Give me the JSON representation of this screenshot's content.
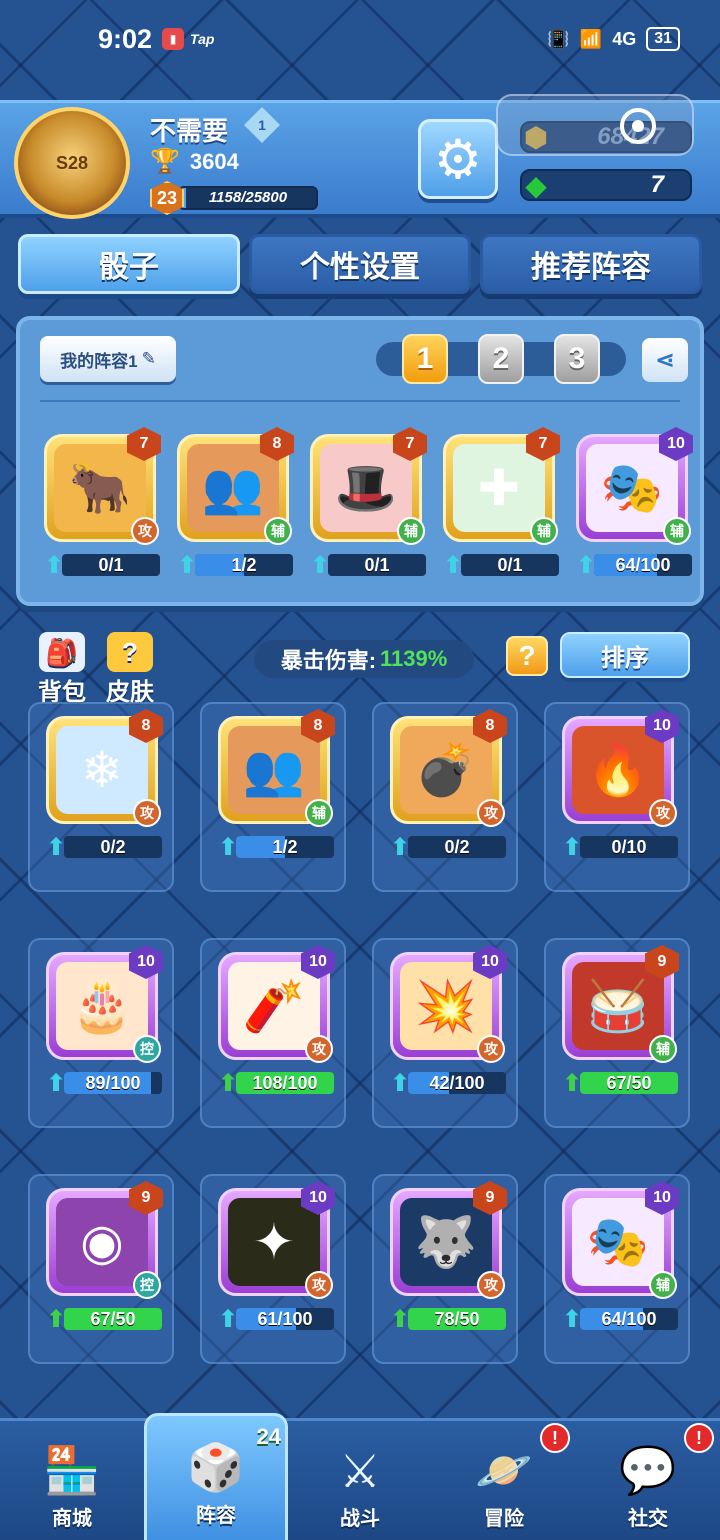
{
  "status_bar": {
    "time": "9:02",
    "app_tag": "Tap",
    "network": "4G",
    "battery": "31"
  },
  "header": {
    "rank_badge": "S28",
    "player_name": "不需要",
    "vip_level": "1",
    "trophies": "3604",
    "level": "23",
    "xp_text": "1158/25800",
    "xp_fraction": 0.045,
    "coins": "68427",
    "gems": "7"
  },
  "tabs": [
    {
      "label": "骰子",
      "active": true
    },
    {
      "label": "个性设置",
      "active": false
    },
    {
      "label": "推荐阵容",
      "active": false
    }
  ],
  "lineup": {
    "my_lineup_label": "我的阵容1",
    "slots": [
      "1",
      "2",
      "3"
    ],
    "active_slot": "1",
    "dice": [
      {
        "icon": "bull-icon",
        "glyph": "🐂",
        "level": "7",
        "type": "攻",
        "progress": "0/1",
        "fraction": 0.0,
        "frame": "gold",
        "bg": "#f2b64a"
      },
      {
        "icon": "twins-icon",
        "glyph": "👥",
        "level": "8",
        "type": "辅",
        "progress": "1/2",
        "fraction": 0.5,
        "frame": "gold",
        "bg": "#e59a5c"
      },
      {
        "icon": "hat-icon",
        "glyph": "🎩",
        "level": "7",
        "type": "辅",
        "progress": "0/1",
        "fraction": 0.0,
        "frame": "gold",
        "bg": "#f7c9c9"
      },
      {
        "icon": "heal-cross-icon",
        "glyph": "✚",
        "level": "7",
        "type": "辅",
        "progress": "0/1",
        "fraction": 0.0,
        "frame": "gold",
        "bg": "#dff5df"
      },
      {
        "icon": "mask-icon",
        "glyph": "🎭",
        "level": "10",
        "type": "辅",
        "progress": "64/100",
        "fraction": 0.64,
        "frame": "purple",
        "bg": "#f7e9ff"
      }
    ]
  },
  "collection": {
    "bag_label": "背包",
    "skin_label": "皮肤",
    "crit_label": "暴击伤害:",
    "crit_value": "1139%",
    "sort_label": "排序",
    "dice": [
      {
        "icon": "ice-spirit-icon",
        "glyph": "❄",
        "level": "8",
        "type": "攻",
        "progress": "0/2",
        "fraction": 0.0,
        "frame": "gold",
        "bg": "#cfe9ff",
        "arrow": "cyan"
      },
      {
        "icon": "twins-icon",
        "glyph": "👥",
        "level": "8",
        "type": "辅",
        "progress": "1/2",
        "fraction": 0.5,
        "frame": "gold",
        "bg": "#e59a5c",
        "arrow": "cyan"
      },
      {
        "icon": "bomb-icon",
        "glyph": "💣",
        "level": "8",
        "type": "攻",
        "progress": "0/2",
        "fraction": 0.0,
        "frame": "gold",
        "bg": "#f0a85a",
        "arrow": "cyan"
      },
      {
        "icon": "claw-icon",
        "glyph": "🔥",
        "level": "10",
        "type": "攻",
        "progress": "0/10",
        "fraction": 0.0,
        "frame": "purple",
        "bg": "#d9542a",
        "arrow": "cyan"
      },
      {
        "icon": "cake-icon",
        "glyph": "🎂",
        "level": "10",
        "type": "控",
        "progress": "89/100",
        "fraction": 0.89,
        "frame": "purple",
        "bg": "#ffe6cc",
        "arrow": "cyan"
      },
      {
        "icon": "firecracker-icon",
        "glyph": "🧨",
        "level": "10",
        "type": "攻",
        "progress": "108/100",
        "fraction": 1.0,
        "frame": "purple",
        "bg": "#fff3e6",
        "arrow": "green"
      },
      {
        "icon": "explosion-icon",
        "glyph": "💥",
        "level": "10",
        "type": "攻",
        "progress": "42/100",
        "fraction": 0.42,
        "frame": "purple",
        "bg": "#ffe0a8",
        "arrow": "cyan"
      },
      {
        "icon": "drum-icon",
        "glyph": "🥁",
        "level": "9",
        "type": "辅",
        "progress": "67/50",
        "fraction": 1.0,
        "frame": "purple",
        "bg": "#c0392b",
        "arrow": "green"
      },
      {
        "icon": "eye-rune-icon",
        "glyph": "◉",
        "level": "9",
        "type": "控",
        "progress": "67/50",
        "fraction": 1.0,
        "frame": "purple",
        "bg": "#8e44ad",
        "arrow": "green"
      },
      {
        "icon": "magic-circle-icon",
        "glyph": "✦",
        "level": "10",
        "type": "攻",
        "progress": "61/100",
        "fraction": 0.61,
        "frame": "purple",
        "bg": "#2b2b1a",
        "arrow": "cyan"
      },
      {
        "icon": "wolf-icon",
        "glyph": "🐺",
        "level": "9",
        "type": "攻",
        "progress": "78/50",
        "fraction": 1.0,
        "frame": "purple",
        "bg": "#1c3a66",
        "arrow": "green"
      },
      {
        "icon": "mask-icon",
        "glyph": "🎭",
        "level": "10",
        "type": "辅",
        "progress": "64/100",
        "fraction": 0.64,
        "frame": "purple",
        "bg": "#f7e9ff",
        "arrow": "cyan"
      }
    ]
  },
  "bottom_nav": [
    {
      "label": "商城",
      "icon": "shop-icon",
      "glyph": "🏪",
      "active": false
    },
    {
      "label": "阵容",
      "icon": "dice-icon",
      "glyph": "🎲",
      "active": true,
      "count": "24"
    },
    {
      "label": "战斗",
      "icon": "swords-icon",
      "glyph": "⚔",
      "active": false
    },
    {
      "label": "冒险",
      "icon": "planet-icon",
      "glyph": "🪐",
      "active": false,
      "alert": "!"
    },
    {
      "label": "社交",
      "icon": "chat-icon",
      "glyph": "💬",
      "active": false,
      "alert": "!"
    }
  ]
}
